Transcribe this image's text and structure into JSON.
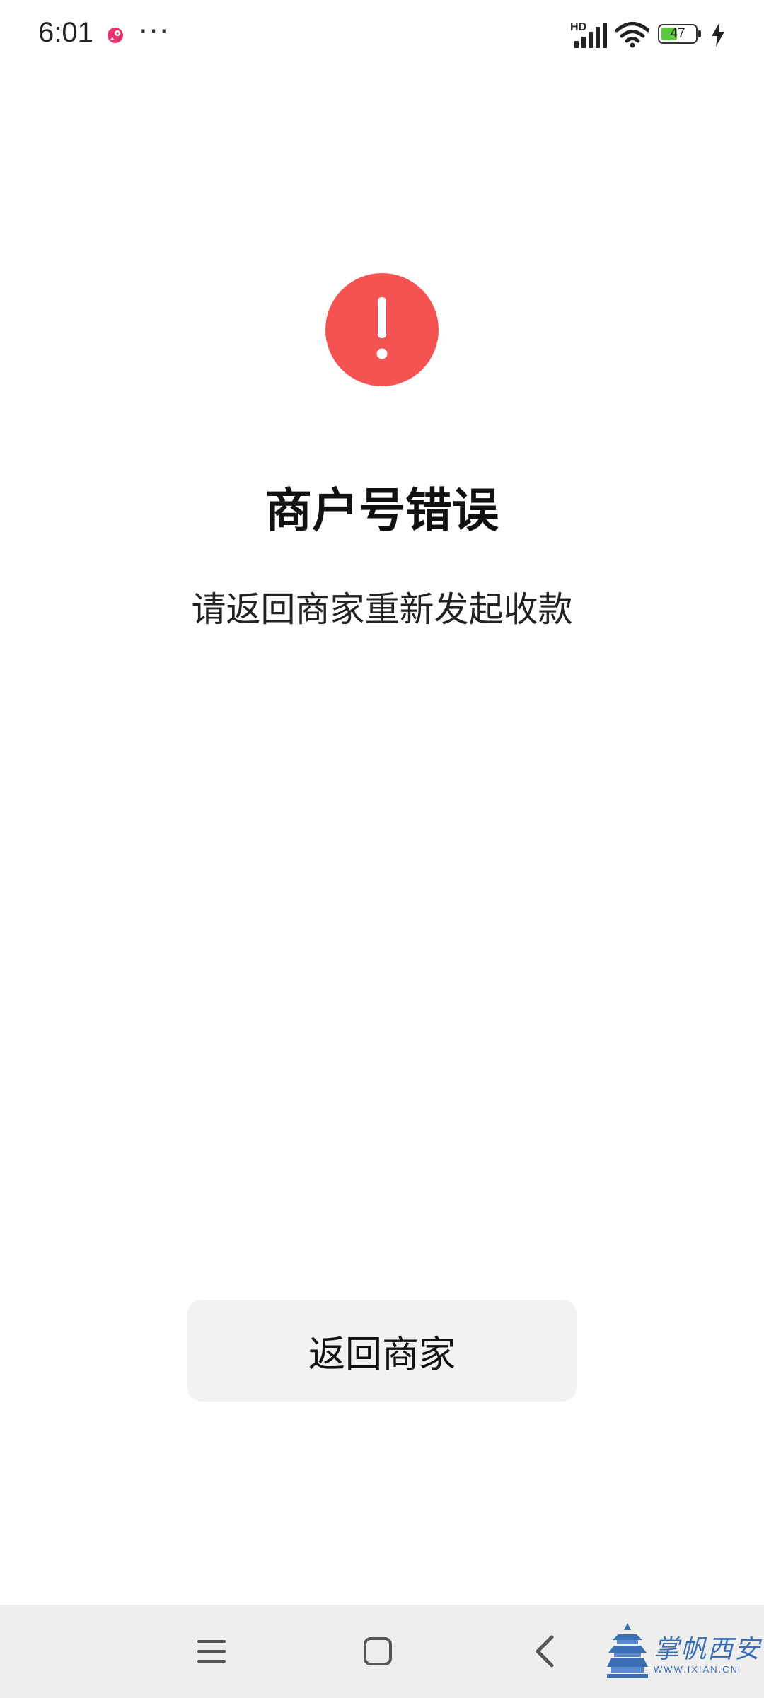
{
  "status_bar": {
    "time": "6:01",
    "more_indicator": "···",
    "network_label": "HD",
    "battery_level": "47",
    "icons": [
      "app-notification-icon",
      "signal-icon",
      "wifi-icon",
      "battery-icon",
      "charging-icon"
    ]
  },
  "error": {
    "icon": "exclamation-circle-icon",
    "icon_color": "#f55252",
    "title": "商户号错误",
    "message": "请返回商家重新发起收款"
  },
  "actions": {
    "return_label": "返回商家"
  },
  "navigation_bar": {
    "icons": [
      "menu-icon",
      "home-square-icon",
      "back-chevron-icon"
    ]
  },
  "watermark": {
    "logo": "pagoda-logo",
    "title": "掌帆西安",
    "subtitle": "WWW.IXIAN.CN",
    "color": "#3b6fb5"
  }
}
